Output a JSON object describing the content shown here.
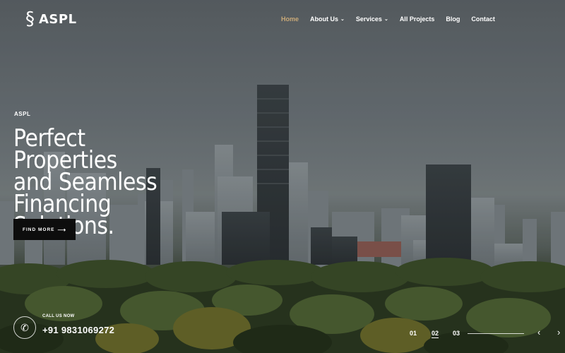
{
  "brand": {
    "name": "ASPL",
    "logo_icon": "s-swirl-logo-icon"
  },
  "nav": {
    "items": [
      {
        "label": "Home",
        "active": true,
        "dropdown": false
      },
      {
        "label": "About Us",
        "active": false,
        "dropdown": true
      },
      {
        "label": "Services",
        "active": false,
        "dropdown": true
      },
      {
        "label": "All Projects",
        "active": false,
        "dropdown": false
      },
      {
        "label": "Blog",
        "active": false,
        "dropdown": false
      },
      {
        "label": "Contact",
        "active": false,
        "dropdown": false
      }
    ],
    "active_color": "#c9a978"
  },
  "hero": {
    "kicker": "ASPL",
    "headline_lines": [
      "Perfect Properties",
      "and Seamless",
      "Financing Solutions."
    ],
    "cta_label": "FIND MORE",
    "cta_icon": "arrow-right-icon"
  },
  "contact": {
    "label": "CALL US NOW",
    "phone": "+91 9831069272",
    "icon": "phone-icon"
  },
  "slider": {
    "slides": [
      "01",
      "02",
      "03"
    ],
    "active_index": 1,
    "prev_icon": "chevron-left-icon",
    "next_icon": "chevron-right-icon"
  }
}
